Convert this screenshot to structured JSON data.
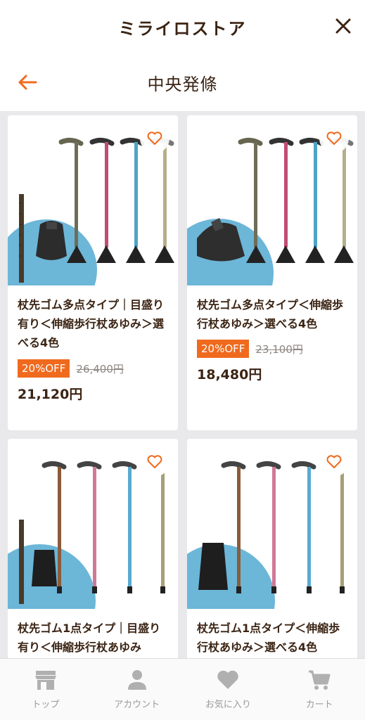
{
  "app": {
    "title": "ミライロストア"
  },
  "subheader": {
    "title": "中央発條"
  },
  "colors": {
    "accent": "#f06a1e",
    "text": "#3b2414",
    "background": "#e9e8ea"
  },
  "products": [
    {
      "title": "杖先ゴム多点タイプ｜目盛り有り＜伸縮歩行杖あゆみ＞選べる4色",
      "discount": "20%OFF",
      "old_price": "26,400円",
      "price": "21,120円"
    },
    {
      "title": "杖先ゴム多点タイプ＜伸縮歩行杖あゆみ＞選べる4色",
      "discount": "20%OFF",
      "old_price": "23,100円",
      "price": "18,480円"
    },
    {
      "title": "杖先ゴム1点タイプ｜目盛り有り＜伸縮歩行杖あゆみ",
      "discount": "",
      "old_price": "",
      "price": ""
    },
    {
      "title": "杖先ゴム1点タイプ＜伸縮歩行杖あゆみ＞選べる4色",
      "discount": "",
      "old_price": "",
      "price": ""
    }
  ],
  "nav": [
    {
      "label": "トップ",
      "icon": "store-icon"
    },
    {
      "label": "アカウント",
      "icon": "person-icon"
    },
    {
      "label": "お気に入り",
      "icon": "heart-icon"
    },
    {
      "label": "カート",
      "icon": "cart-icon"
    }
  ]
}
